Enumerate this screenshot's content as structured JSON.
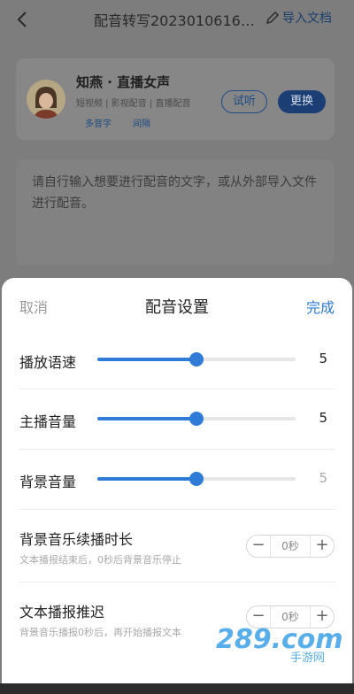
{
  "header": {
    "title": "配音转写20230106161...",
    "import_label": "导入文档"
  },
  "voice": {
    "name": "知燕 · 直播女声",
    "tags": "短视频 | 影视配音 | 直播配音",
    "chips": [
      "多音字",
      "间隔"
    ],
    "listen_label": "试听",
    "change_label": "更换"
  },
  "editor": {
    "placeholder": "请自行输入想要进行配音的文字，或从外部导入文件进行配音。"
  },
  "sheet": {
    "cancel_label": "取消",
    "title": "配音设置",
    "done_label": "完成",
    "sliders": [
      {
        "label": "播放语速",
        "value": "5",
        "fraction": 0.5
      },
      {
        "label": "主播音量",
        "value": "5",
        "fraction": 0.5
      },
      {
        "label": "背景音量",
        "value": "5",
        "fraction": 0.5
      }
    ],
    "steppers": [
      {
        "label": "背景音乐续播时长",
        "sub": "文本播报结束后，0秒后背景音乐停止",
        "value": "0秒",
        "minus": "−",
        "plus": "+"
      },
      {
        "label": "文本播报推迟",
        "sub": "背景音乐播报0秒后，再开始播报文本",
        "value": "0秒",
        "minus": "−",
        "plus": "+"
      }
    ]
  },
  "watermark": {
    "text": "289.com",
    "sub": "手游网"
  },
  "colors": {
    "accent": "#2f7bd8",
    "dim": "#7d7d7d",
    "dark_blue": "#1b3f75"
  }
}
